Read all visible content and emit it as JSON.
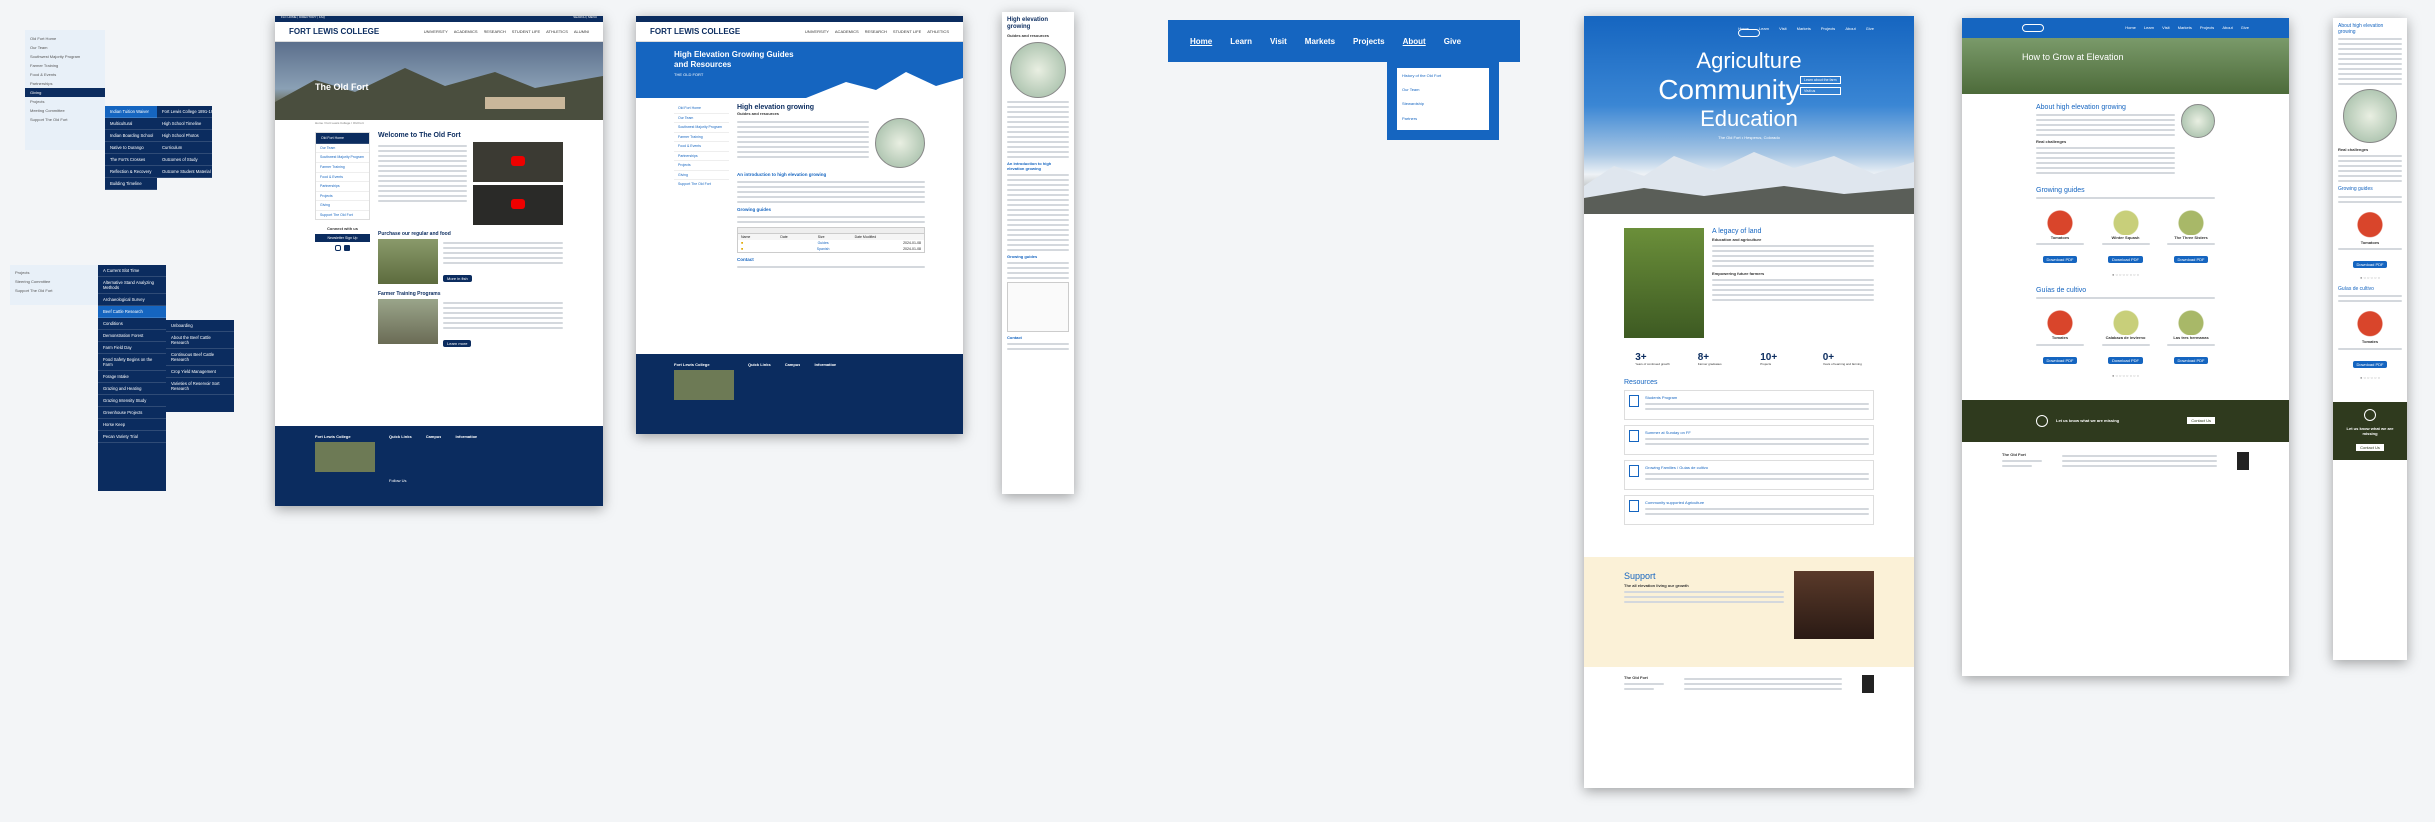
{
  "college": {
    "name": "FORT LEWIS COLLEGE",
    "topbar_left": "FLC HOME | DIRECTORY | FAQ",
    "topbar_right": "SEARCH | MENU"
  },
  "mainnav": [
    "UNIVERSITY",
    "ACADEMICS",
    "RESEARCH",
    "STUDENT LIFE",
    "ATHLETICS",
    "ALUMNI"
  ],
  "p1": {
    "items": [
      "Old Fort Home",
      "Our Team",
      "Southwest Majority Program",
      "Farmer Training",
      "Food & Events",
      "Partnerships",
      "Giving",
      "Projects",
      "Meeting Committee",
      "Support The Old Fort"
    ],
    "col2": [
      "Indian Tuition Waiver",
      "Multicultural",
      "Indian Boarding School",
      "Native to Durango",
      "The Fort's Crosses",
      "Reflection & Recovery",
      "Building Timeline"
    ],
    "col3": [
      "Fort Lewis College 1891-1911",
      "High School Timeline",
      "High School Photos",
      "Curriculum",
      "Outcomes of Study",
      "Outcome Student Material"
    ]
  },
  "p2": {
    "items": [
      "Projects",
      "Steering Committee",
      "Support The Old Fort"
    ],
    "col2": [
      "A Current Slot Time",
      "Alternative Stand Analyzing Methods",
      "Archaeological Survey",
      "Beef Cattle Research",
      "Conditions",
      "Demonstration Forest",
      "Farm Field Day",
      "Food Safety Begins on the Farm",
      "Forage Intake",
      "Grazing and Heating",
      "Grazing Intensity Study",
      "Greenhouse Projects",
      "Horse Keep",
      "Pecan Variety Trial"
    ],
    "col3": [
      "Unboarding",
      "About the Beef Cattle Research",
      "Continuous Beef Cattle Research",
      "Crop Yield Management",
      "Varieties of Reservoir Sort Research"
    ]
  },
  "p3": {
    "title": "The Old Fort",
    "breadcrumb": "Home / Fort Lewis College / Old Fort",
    "welcome": "Welcome to The Old Fort",
    "sidenav": [
      "Old Fort Home",
      "Our Team",
      "Southwest Majority Program",
      "Farmer Training",
      "Food & Events",
      "Partnerships",
      "Projects",
      "Giving",
      "Support The Old Fort"
    ],
    "connect": "Connect with us",
    "signup": "Newsletter Sign Up",
    "purchase": "Purchase our regular and food",
    "more": "More in fish",
    "farmer": "Farmer Training Programs",
    "learnmore": "Learn more",
    "footer": {
      "name": "Fort Lewis College",
      "cols": [
        "Quick Links",
        "Campus",
        "Information"
      ],
      "social": "Follow Us"
    }
  },
  "p4": {
    "title": "High Elevation Growing Guides and Resources",
    "sub": "THE OLD FORT",
    "h1": "High elevation growing",
    "guide_label": "Guides and resources",
    "intro": "An introduction to high elevation growing",
    "growing": "Growing guides",
    "contact": "Contact",
    "table_head": [
      "Name",
      "Date",
      "Size",
      "Date Modified"
    ],
    "table_rows": [
      [
        "Guides",
        "",
        "",
        "2024-01-08"
      ],
      [
        "Spanish",
        "",
        "",
        "2024-01-08"
      ]
    ]
  },
  "p5": {
    "title": "High elevation growing",
    "sub": "Guides and resources",
    "intro": "An introduction to high elevation growing",
    "growing": "Growing guides",
    "contact": "Contact"
  },
  "p6": {
    "nav": [
      "Home",
      "Learn",
      "Visit",
      "Markets",
      "Projects",
      "About",
      "Give"
    ],
    "dropdown": [
      "History of the Old Fort",
      "Our Team",
      "Stewardship",
      "Partners"
    ]
  },
  "p7": {
    "nav": [
      "Home",
      "Learn",
      "Visit",
      "Markets",
      "Projects",
      "About",
      "Give"
    ],
    "hero1": "Agriculture",
    "hero2": "Community",
    "hero3": "Education",
    "hero_sub": "The Old Fort • Hesperus, Colorado",
    "hero_btn1": "Learn about the farm",
    "hero_btn2": "Visit us",
    "legacy": "A legacy of land",
    "legacy_sub": "Education and agriculture",
    "education": "Empowering future farmers",
    "stats": [
      {
        "n": "3+",
        "l": "Years of continued growth"
      },
      {
        "n": "8+",
        "l": "Farmer graduates"
      },
      {
        "n": "10+",
        "l": "Projects"
      },
      {
        "n": "0+",
        "l": "Years of learning and farming"
      }
    ],
    "resources": "Resources",
    "res": [
      "Students Program",
      "Summer at Sunday on FF",
      "Growing Families / Guías de cultivo",
      "Community supported Agriculture"
    ],
    "support": "Support",
    "support_sub": "The all elevation living our growth",
    "footer_name": "The Old Fort"
  },
  "p8": {
    "hero": "How to Grow at Elevation",
    "about": "About high elevation growing",
    "real": "Real challenges",
    "guides": "Growing guides",
    "crops": [
      "Tomatoes",
      "Winter Squash",
      "The Three Sisters"
    ],
    "spanish": "Guías de cultivo",
    "crops_es": [
      "Tomates",
      "Calabaza de invierno",
      "Las tres hermanas"
    ],
    "dl": "Download PDF",
    "cta": "Let us know what we are missing",
    "cta_btn": "Contact Us",
    "footer": "The Old Fort"
  },
  "p9": {
    "title": "About high elevation growing",
    "real": "Real challenges",
    "guides": "Growing guides",
    "crop": "Tomatoes",
    "spanish": "Guías de cultivo",
    "crop_es": "Tomates",
    "cta": "Let us know what we are missing",
    "cta_btn": "Contact Us"
  },
  "colors": {
    "navy": "#0b2c5f",
    "blue": "#1565c0",
    "olive": "#2f3a1e",
    "cream": "#fbf1d7"
  }
}
